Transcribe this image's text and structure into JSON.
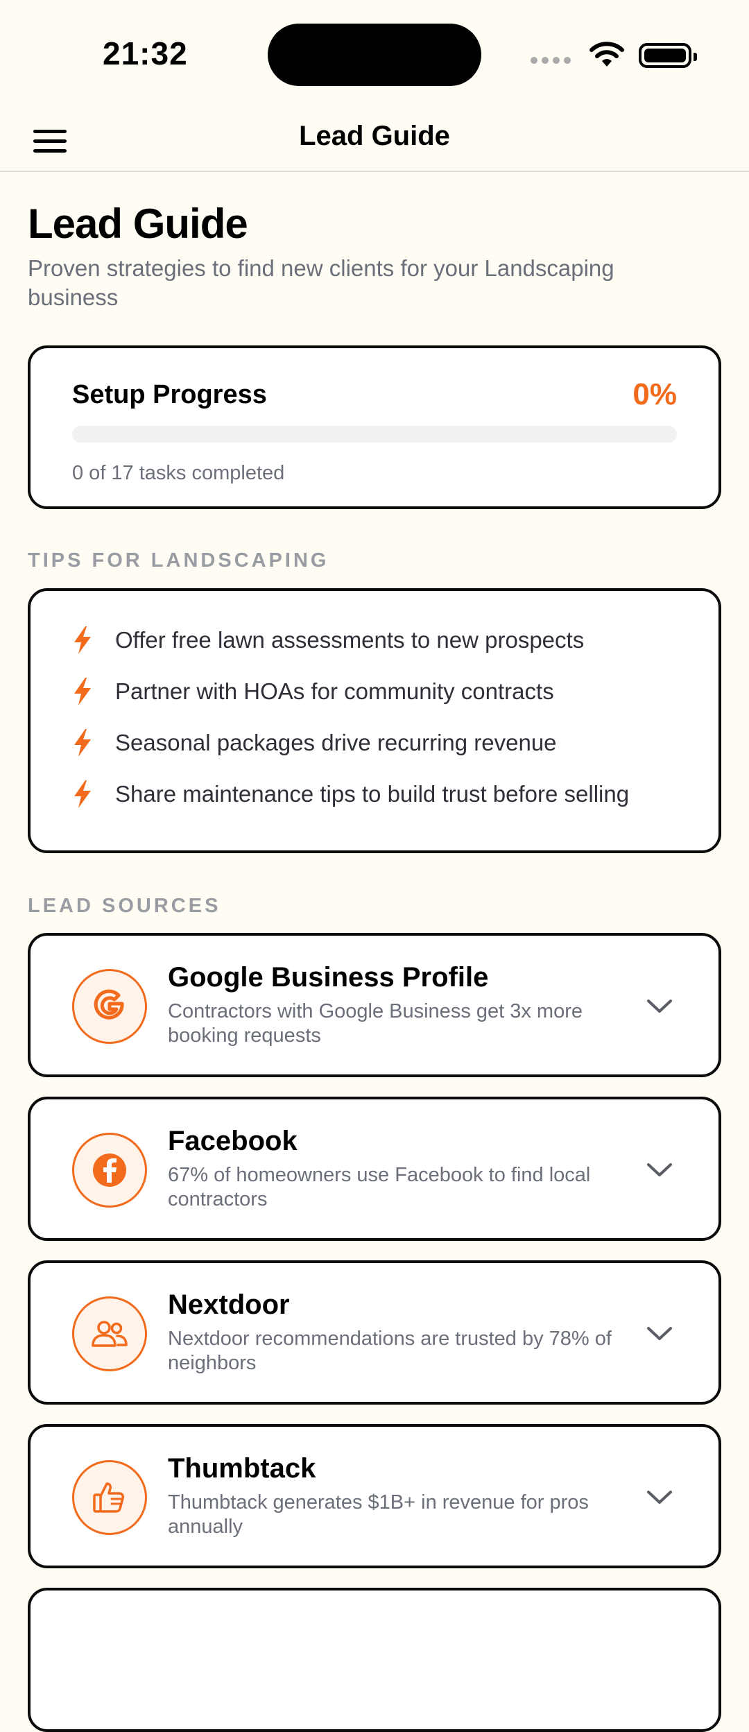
{
  "status_bar": {
    "time": "21:32"
  },
  "nav": {
    "title": "Lead Guide"
  },
  "header": {
    "title": "Lead Guide",
    "subtitle": "Proven strategies to find new clients for your Landscaping business"
  },
  "progress": {
    "label": "Setup Progress",
    "percent_text": "0%",
    "percent_value": 0,
    "note": "0 of 17 tasks completed"
  },
  "tips": {
    "section_label": "TIPS FOR LANDSCAPING",
    "items": [
      "Offer free lawn assessments to new prospects",
      "Partner with HOAs for community contracts",
      "Seasonal packages drive recurring revenue",
      "Share maintenance tips to build trust before selling"
    ],
    "icon": "bolt-icon"
  },
  "sources": {
    "section_label": "LEAD SOURCES",
    "items": [
      {
        "title": "Google Business Profile",
        "description": "Contractors with Google Business get 3x more booking requests",
        "icon": "google-icon"
      },
      {
        "title": "Facebook",
        "description": "67% of homeowners use Facebook to find local contractors",
        "icon": "facebook-icon"
      },
      {
        "title": "Nextdoor",
        "description": "Nextdoor recommendations are trusted by 78% of neighbors",
        "icon": "people-icon"
      },
      {
        "title": "Thumbtack",
        "description": "Thumbtack generates $1B+ in revenue for pros annually",
        "icon": "thumbs-up-icon"
      }
    ]
  },
  "colors": {
    "accent": "#F26A1B",
    "background": "#FFFCF4",
    "card_border": "#0A0A0A",
    "muted_text": "#6B6F7A",
    "section_label": "#9A9CA3"
  }
}
